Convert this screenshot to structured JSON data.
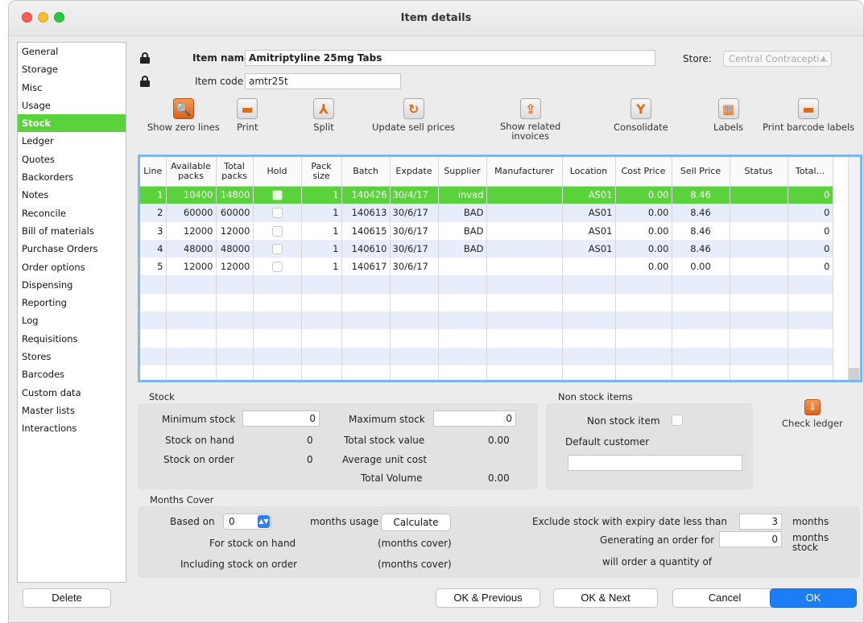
{
  "window": {
    "title": "Item details"
  },
  "sidebar": {
    "items": [
      {
        "label": "General",
        "active": false
      },
      {
        "label": "Storage",
        "active": false
      },
      {
        "label": "Misc",
        "active": false
      },
      {
        "label": "Usage",
        "active": false
      },
      {
        "label": "Stock",
        "active": true
      },
      {
        "label": "Ledger",
        "active": false
      },
      {
        "label": "Quotes",
        "active": false
      },
      {
        "label": "Backorders",
        "active": false
      },
      {
        "label": "Notes",
        "active": false
      },
      {
        "label": "Reconcile",
        "active": false
      },
      {
        "label": "Bill of materials",
        "active": false
      },
      {
        "label": "Purchase Orders",
        "active": false
      },
      {
        "label": "Order options",
        "active": false
      },
      {
        "label": "Dispensing",
        "active": false
      },
      {
        "label": "Reporting",
        "active": false
      },
      {
        "label": "Log",
        "active": false
      },
      {
        "label": "Requisitions",
        "active": false
      },
      {
        "label": "Stores",
        "active": false
      },
      {
        "label": "Barcodes",
        "active": false
      },
      {
        "label": "Custom data",
        "active": false
      },
      {
        "label": "Master lists",
        "active": false
      },
      {
        "label": "Interactions",
        "active": false
      }
    ]
  },
  "header": {
    "item_name_label": "Item name",
    "item_name_value": "Amitriptyline 25mg Tabs",
    "item_code_label": "Item code",
    "item_code_value": "amtr25t",
    "store_label": "Store:",
    "store_value": "Central Contracepti..."
  },
  "toolbar": {
    "show_zero_lines": "Show zero lines",
    "print": "Print",
    "split": "Split",
    "update_sell_prices": "Update sell prices",
    "show_related_invoices_1": "Show related",
    "show_related_invoices_2": "invoices",
    "consolidate": "Consolidate",
    "labels": "Labels",
    "print_barcode_labels": "Print barcode labels"
  },
  "table": {
    "columns": [
      "Line",
      "Available packs",
      "Total packs",
      "Hold",
      "Pack size",
      "Batch",
      "Expdate",
      "Supplier",
      "Manufacturer",
      "Location",
      "Cost Price",
      "Sell Price",
      "Status",
      "Total..."
    ],
    "rows": [
      {
        "line": "1",
        "available": "10400",
        "total": "14800",
        "hold": false,
        "pack_size": "1",
        "batch": "140426",
        "expdate": "30/4/17",
        "supplier": "invad",
        "manufacturer": "",
        "location": "AS01",
        "cost": "0.00",
        "sell": "8.46",
        "status": "",
        "total_col": "0"
      },
      {
        "line": "2",
        "available": "60000",
        "total": "60000",
        "hold": false,
        "pack_size": "1",
        "batch": "140613",
        "expdate": "30/6/17",
        "supplier": "BAD",
        "manufacturer": "",
        "location": "AS01",
        "cost": "0.00",
        "sell": "8.46",
        "status": "",
        "total_col": "0"
      },
      {
        "line": "3",
        "available": "12000",
        "total": "12000",
        "hold": false,
        "pack_size": "1",
        "batch": "140615",
        "expdate": "30/6/17",
        "supplier": "BAD",
        "manufacturer": "",
        "location": "AS01",
        "cost": "0.00",
        "sell": "8.46",
        "status": "",
        "total_col": "0"
      },
      {
        "line": "4",
        "available": "48000",
        "total": "48000",
        "hold": false,
        "pack_size": "1",
        "batch": "140610",
        "expdate": "30/6/17",
        "supplier": "BAD",
        "manufacturer": "",
        "location": "AS01",
        "cost": "0.00",
        "sell": "8.46",
        "status": "",
        "total_col": "0"
      },
      {
        "line": "5",
        "available": "12000",
        "total": "12000",
        "hold": false,
        "pack_size": "1",
        "batch": "140617",
        "expdate": "30/6/17",
        "supplier": "",
        "manufacturer": "",
        "location": "",
        "cost": "0.00",
        "sell": "0.00",
        "status": "",
        "total_col": "0"
      }
    ],
    "selected_row": 0
  },
  "stock": {
    "title": "Stock",
    "minimum_stock_label": "Minimum stock",
    "minimum_stock_value": "0",
    "maximum_stock_label": "Maximum stock",
    "maximum_stock_value": "0",
    "stock_on_hand_label": "Stock on hand",
    "stock_on_hand_value": "0",
    "total_stock_value_label": "Total stock value",
    "total_stock_value_value": "0.00",
    "stock_on_order_label": "Stock on order",
    "stock_on_order_value": "0",
    "average_unit_cost_label": "Average unit cost",
    "total_volume_label": "Total Volume",
    "total_volume_value": "0.00"
  },
  "non_stock": {
    "title": "Non stock items",
    "non_stock_item_label": "Non stock item",
    "default_customer_label": "Default customer",
    "default_customer_value": ""
  },
  "check_ledger": {
    "label": "Check ledger"
  },
  "months_cover": {
    "title": "Months Cover",
    "based_on_label": "Based on",
    "based_on_value": "0",
    "months_usage_label": "months usage",
    "calculate_label": "Calculate",
    "for_stock_on_hand_label": "For stock on hand",
    "for_stock_on_hand_value": "(months cover)",
    "including_stock_on_order_label": "Including stock on order",
    "including_stock_on_order_value": "(months cover)",
    "exclude_label": "Exclude stock with expiry date less than",
    "exclude_value": "3",
    "exclude_unit": "months",
    "generating_label": "Generating an order for",
    "generating_value": "0",
    "generating_unit_1": "months",
    "generating_unit_2": "stock",
    "will_order_label": "will order a quantity of"
  },
  "footer": {
    "delete": "Delete",
    "ok_previous": "OK & Previous",
    "ok_next": "OK & Next",
    "cancel": "Cancel",
    "ok": "OK"
  },
  "colors": {
    "selection": "#5ad23b",
    "primary": "#1b7ef6",
    "accent_icon": "#e06a1b"
  }
}
